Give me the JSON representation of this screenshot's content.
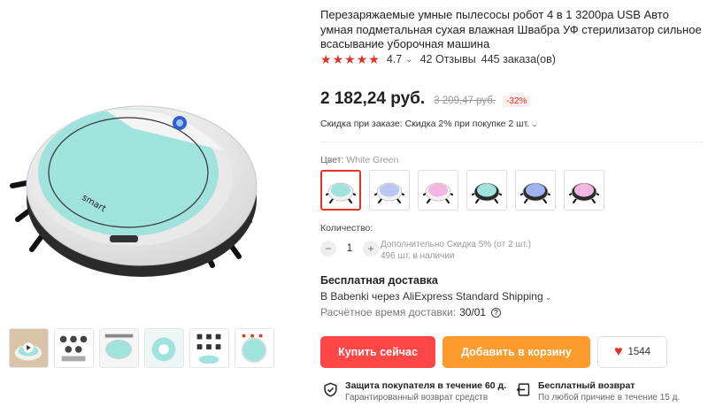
{
  "product": {
    "title": "Перезаряжаемые умные пылесосы робот 4 в 1 3200pa USB Авто умная подметальная сухая влажная Швабра УФ стерилизатор сильное всасывание уборочная машина",
    "rating_stars": 5,
    "rating": "4.7",
    "reviews": "42 Отзывы",
    "orders": "445 заказа(ов)",
    "device_text": "smart"
  },
  "pricing": {
    "price": "2 182,24 руб.",
    "old_price": "3 209,47 руб.",
    "discount": "-32%",
    "coupon": "Скидка при заказе: Скидка 2% при покупке 2 шт."
  },
  "color": {
    "label": "Цвет:",
    "selected": "White Green",
    "options": [
      {
        "name": "White Green",
        "hex": "#9fe3dc",
        "body": "#f2f2f2"
      },
      {
        "name": "White Blue",
        "hex": "#b8c6f0",
        "body": "#f2f2f2"
      },
      {
        "name": "White Pink",
        "hex": "#f3b6e3",
        "body": "#f2f2f2"
      },
      {
        "name": "Black Green",
        "hex": "#9fe3dc",
        "body": "#2a2a2a"
      },
      {
        "name": "Black Blue",
        "hex": "#9fb2f2",
        "body": "#2a2a2a"
      },
      {
        "name": "Black Pink",
        "hex": "#f3b6e3",
        "body": "#2a2a2a"
      }
    ]
  },
  "quantity": {
    "label": "Количество:",
    "value": "1",
    "discount_note": "Дополнительно Скидка 5% (от 2 шт.)",
    "stock": "496 шт. в наличии"
  },
  "shipping": {
    "title": "Бесплатная доставка",
    "method": "В Babenki через AliExpress Standard Shipping",
    "time_label": "Расчётное время доставки:",
    "time_value": "30/01"
  },
  "actions": {
    "buy": "Купить сейчас",
    "cart": "Добавить в корзину",
    "wishlist_count": "1544"
  },
  "guarantees": [
    {
      "title": "Защита покупателя в течение 60 д.",
      "subtitle": "Гарантированный возврат средств",
      "icon": "shield-check-icon"
    },
    {
      "title": "Бесплатный возврат",
      "subtitle": "По любой причине в течение 15 д.",
      "icon": "return-icon"
    }
  ],
  "colors": {
    "accent": "#e43225",
    "buy": "#ff4747",
    "cart": "#fd9b2d",
    "device_top": "#9fe3dc"
  }
}
